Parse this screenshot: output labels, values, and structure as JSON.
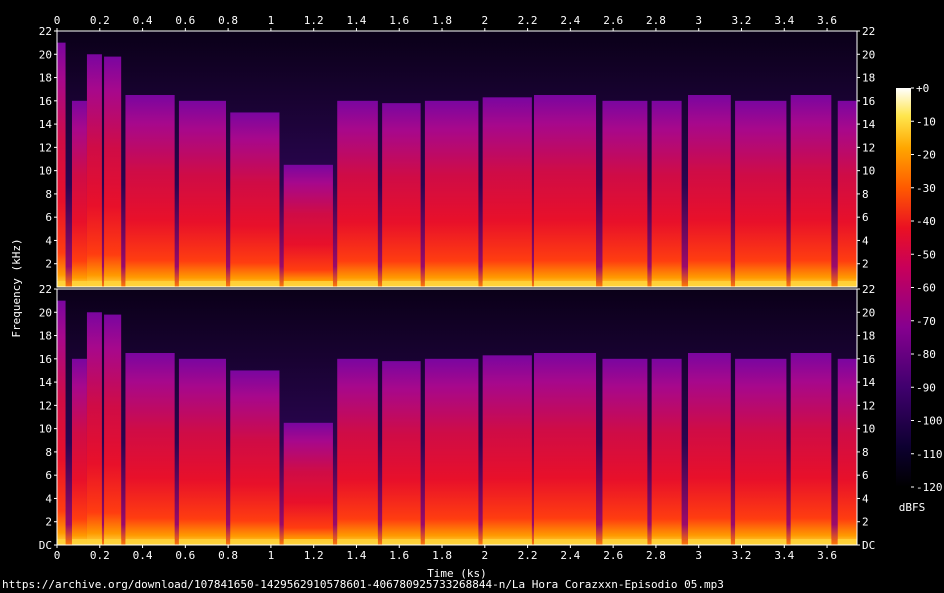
{
  "chart_data": {
    "type": "heatmap",
    "title": "",
    "source_url": "https://archive.org/download/107841650-1429562910578601-406780925733268844-n/La Hora Corazxxn-Episodio 05.mp3",
    "xlabel": "Time (ks)",
    "ylabel": "Frequency (kHz)",
    "xlim": [
      0,
      3.74
    ],
    "ylim": [
      0,
      22
    ],
    "x_ticks": [
      "0",
      "0.2",
      "0.4",
      "0.6",
      "0.8",
      "1",
      "1.2",
      "1.4",
      "1.6",
      "1.8",
      "2",
      "2.2",
      "2.4",
      "2.6",
      "2.8",
      "3",
      "3.2",
      "3.4",
      "3.6"
    ],
    "x_tick_values": [
      0,
      0.2,
      0.4,
      0.6,
      0.8,
      1.0,
      1.2,
      1.4,
      1.6,
      1.8,
      2.0,
      2.2,
      2.4,
      2.6,
      2.8,
      3.0,
      3.2,
      3.4,
      3.6
    ],
    "y_ticks": [
      "22",
      "20",
      "18",
      "16",
      "14",
      "12",
      "10",
      "8",
      "6",
      "4",
      "2"
    ],
    "y_tick_values": [
      22,
      20,
      18,
      16,
      14,
      12,
      10,
      8,
      6,
      4,
      2
    ],
    "y_bottom_label": "DC",
    "channels": [
      "left",
      "right"
    ],
    "colorbar": {
      "label": "dBFS",
      "ticks": [
        "+0",
        "-10",
        "-20",
        "-30",
        "-40",
        "-50",
        "-60",
        "-70",
        "-80",
        "-90",
        "-100",
        "-110",
        "-120"
      ],
      "range": [
        -120,
        0
      ]
    },
    "segments": [
      {
        "start": 0.0,
        "end": 0.04,
        "cutoff_khz": 21.0
      },
      {
        "start": 0.07,
        "end": 0.14,
        "cutoff_khz": 16.0
      },
      {
        "start": 0.14,
        "end": 0.21,
        "cutoff_khz": 20.0
      },
      {
        "start": 0.22,
        "end": 0.3,
        "cutoff_khz": 19.8
      },
      {
        "start": 0.32,
        "end": 0.55,
        "cutoff_khz": 16.5
      },
      {
        "start": 0.57,
        "end": 0.79,
        "cutoff_khz": 16.0
      },
      {
        "start": 0.81,
        "end": 1.04,
        "cutoff_khz": 15.0
      },
      {
        "start": 1.06,
        "end": 1.29,
        "cutoff_khz": 10.5
      },
      {
        "start": 1.31,
        "end": 1.5,
        "cutoff_khz": 16.0
      },
      {
        "start": 1.52,
        "end": 1.7,
        "cutoff_khz": 15.8
      },
      {
        "start": 1.72,
        "end": 1.97,
        "cutoff_khz": 16.0
      },
      {
        "start": 1.99,
        "end": 2.22,
        "cutoff_khz": 16.3
      },
      {
        "start": 2.23,
        "end": 2.52,
        "cutoff_khz": 16.5
      },
      {
        "start": 2.55,
        "end": 2.76,
        "cutoff_khz": 16.0
      },
      {
        "start": 2.78,
        "end": 2.92,
        "cutoff_khz": 16.0
      },
      {
        "start": 2.95,
        "end": 3.15,
        "cutoff_khz": 16.5
      },
      {
        "start": 3.17,
        "end": 3.41,
        "cutoff_khz": 16.0
      },
      {
        "start": 3.43,
        "end": 3.62,
        "cutoff_khz": 16.5
      },
      {
        "start": 3.65,
        "end": 3.74,
        "cutoff_khz": 16.0
      }
    ]
  }
}
